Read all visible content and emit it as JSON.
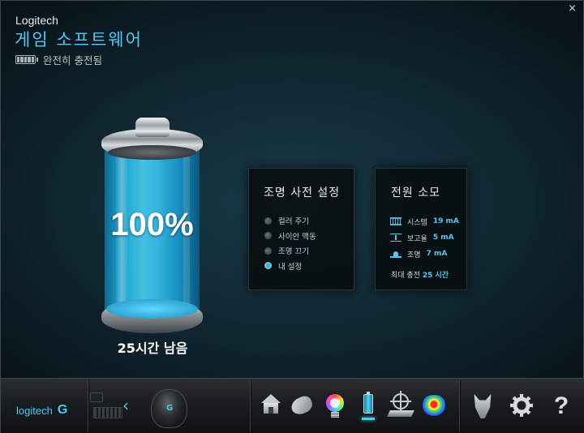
{
  "window": {
    "close_label": "×",
    "brand": "Logitech",
    "title": "게임 소프트웨어",
    "charge_status": "완전히 충전됨"
  },
  "battery": {
    "percent_text": "100%",
    "level": 1.0,
    "time_left": "25시간 남음"
  },
  "lighting_presets": {
    "title": "조명 사전 설정",
    "options": [
      {
        "label": "컬러 주기",
        "selected": false
      },
      {
        "label": "사이안 맥동",
        "selected": false
      },
      {
        "label": "조명 끄기",
        "selected": false
      },
      {
        "label": "내 설정",
        "selected": true
      }
    ]
  },
  "power_consumption": {
    "title": "전원 소모",
    "items": [
      {
        "label": "시스템",
        "value": "19 mA",
        "icon": "system-icon"
      },
      {
        "label": "보고율",
        "value": "5 mA",
        "icon": "report-rate-icon"
      },
      {
        "label": "조명",
        "value": "7 mA",
        "icon": "lighting-icon"
      }
    ],
    "max_charge_label": "최대 충전",
    "max_charge_value": "25 시간"
  },
  "footer": {
    "logo_text": "logitech",
    "logo_glyph": "G",
    "nav_arrow": "‹",
    "tools": [
      "home-icon",
      "mouse-buttons-icon",
      "lighting-icon",
      "battery-icon",
      "dpi-icon",
      "heatmap-icon",
      "arx-wolf-icon",
      "settings-gear-icon",
      "help-icon"
    ],
    "help_label": "?"
  },
  "colors": {
    "accent": "#4ec8f0",
    "panel_bg": "#080c0e"
  }
}
